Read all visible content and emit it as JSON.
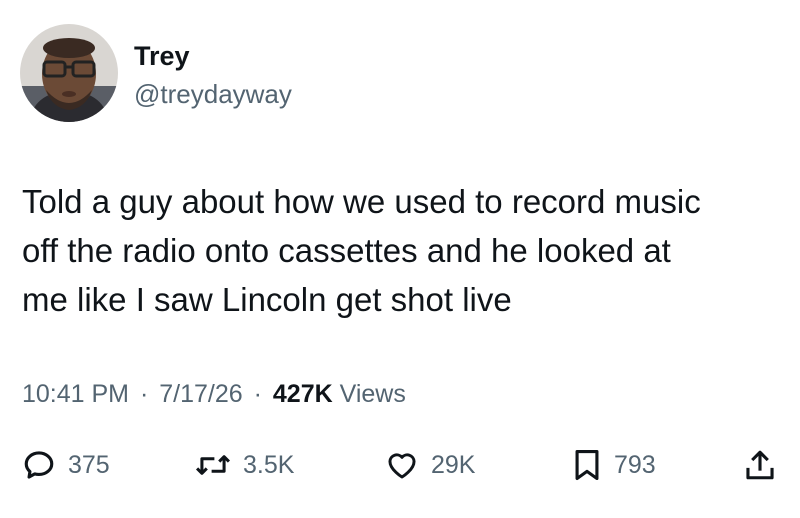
{
  "author": {
    "display_name": "Trey",
    "handle": "@treydayway"
  },
  "tweet": {
    "text": "Told a guy about how we used to record music\noff the radio onto cassettes and he looked at\nme like I saw Lincoln get shot live",
    "time": "10:41 PM",
    "date": "7/17/26",
    "separator": "·",
    "views_count": "427K",
    "views_label": "Views"
  },
  "actions": {
    "replies": "375",
    "retweets": "3.5K",
    "likes": "29K",
    "bookmarks": "793"
  },
  "icons": {
    "reply": "speech-bubble-icon",
    "retweet": "retweet-arrows-icon",
    "like": "heart-icon",
    "bookmark": "bookmark-icon",
    "share": "share-upload-icon"
  },
  "colors": {
    "text": "#0f1419",
    "secondary": "#536471",
    "background": "#ffffff"
  }
}
